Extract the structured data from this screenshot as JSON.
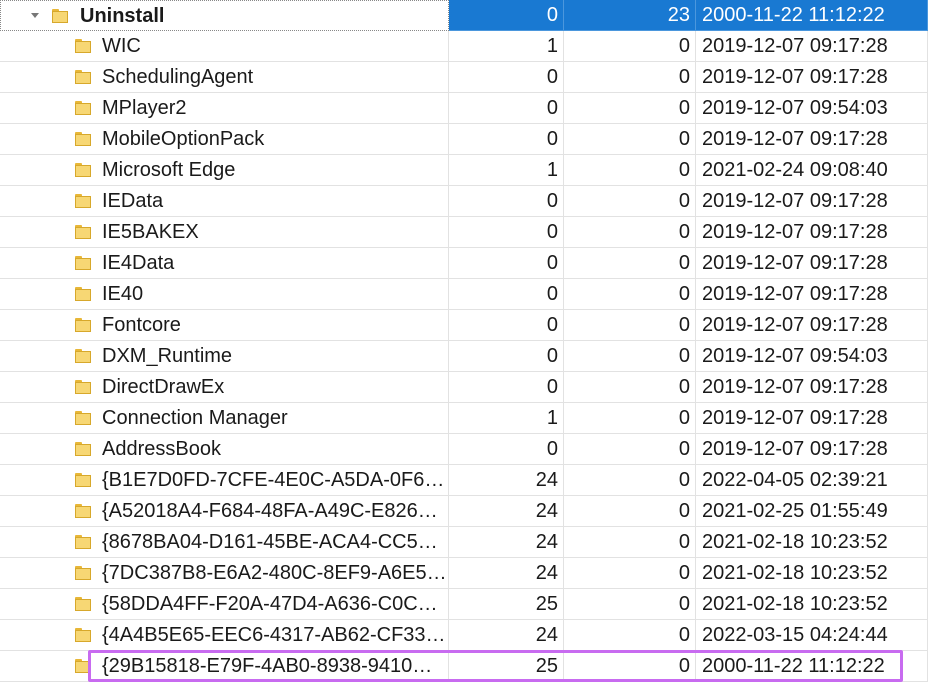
{
  "root": {
    "name": "Uninstall",
    "subkeys": "0",
    "values": "23",
    "date": "2000-11-22 11:12:22"
  },
  "rows": [
    {
      "name": "WIC",
      "subkeys": "1",
      "values": "0",
      "date": "2019-12-07 09:17:28"
    },
    {
      "name": "SchedulingAgent",
      "subkeys": "0",
      "values": "0",
      "date": "2019-12-07 09:17:28"
    },
    {
      "name": "MPlayer2",
      "subkeys": "0",
      "values": "0",
      "date": "2019-12-07 09:54:03"
    },
    {
      "name": "MobileOptionPack",
      "subkeys": "0",
      "values": "0",
      "date": "2019-12-07 09:17:28"
    },
    {
      "name": "Microsoft Edge",
      "subkeys": "1",
      "values": "0",
      "date": "2021-02-24 09:08:40"
    },
    {
      "name": "IEData",
      "subkeys": "0",
      "values": "0",
      "date": "2019-12-07 09:17:28"
    },
    {
      "name": "IE5BAKEX",
      "subkeys": "0",
      "values": "0",
      "date": "2019-12-07 09:17:28"
    },
    {
      "name": "IE4Data",
      "subkeys": "0",
      "values": "0",
      "date": "2019-12-07 09:17:28"
    },
    {
      "name": "IE40",
      "subkeys": "0",
      "values": "0",
      "date": "2019-12-07 09:17:28"
    },
    {
      "name": "Fontcore",
      "subkeys": "0",
      "values": "0",
      "date": "2019-12-07 09:17:28"
    },
    {
      "name": "DXM_Runtime",
      "subkeys": "0",
      "values": "0",
      "date": "2019-12-07 09:54:03"
    },
    {
      "name": "DirectDrawEx",
      "subkeys": "0",
      "values": "0",
      "date": "2019-12-07 09:17:28"
    },
    {
      "name": "Connection Manager",
      "subkeys": "1",
      "values": "0",
      "date": "2019-12-07 09:17:28"
    },
    {
      "name": "AddressBook",
      "subkeys": "0",
      "values": "0",
      "date": "2019-12-07 09:17:28"
    },
    {
      "name": "{B1E7D0FD-7CFE-4E0C-A5DA-0F6…",
      "subkeys": "24",
      "values": "0",
      "date": "2022-04-05 02:39:21"
    },
    {
      "name": "{A52018A4-F684-48FA-A49C-E826…",
      "subkeys": "24",
      "values": "0",
      "date": "2021-02-25 01:55:49"
    },
    {
      "name": "{8678BA04-D161-45BE-ACA4-CC5…",
      "subkeys": "24",
      "values": "0",
      "date": "2021-02-18 10:23:52"
    },
    {
      "name": "{7DC387B8-E6A2-480C-8EF9-A6E5…",
      "subkeys": "24",
      "values": "0",
      "date": "2021-02-18 10:23:52"
    },
    {
      "name": "{58DDA4FF-F20A-47D4-A636-C0C…",
      "subkeys": "25",
      "values": "0",
      "date": "2021-02-18 10:23:52"
    },
    {
      "name": "{4A4B5E65-EEC6-4317-AB62-CF33…",
      "subkeys": "24",
      "values": "0",
      "date": "2022-03-15 04:24:44"
    },
    {
      "name": "{29B15818-E79F-4AB0-8938-9410…",
      "subkeys": "25",
      "values": "0",
      "date": "2000-11-22 11:12:22"
    }
  ],
  "colors": {
    "selection": "#1979d2",
    "highlight_outline": "#c86bf0",
    "folder": "#f7d774"
  }
}
